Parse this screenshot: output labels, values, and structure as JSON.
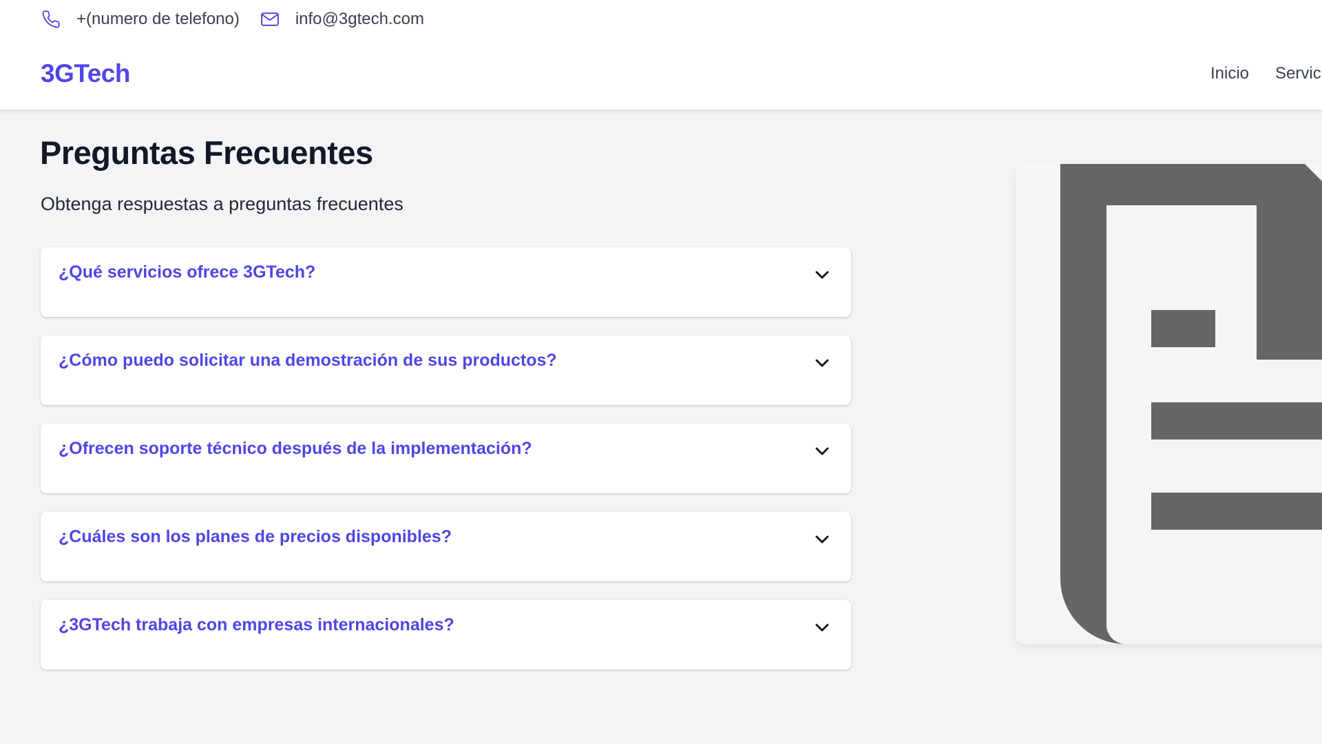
{
  "topbar": {
    "phone": "+(numero de telefono)",
    "email": "info@3gtech.com"
  },
  "brand": "3GTech",
  "nav": [
    "Inicio",
    "Servicios"
  ],
  "faq": {
    "title": "Preguntas Frecuentes",
    "subtitle": "Obtenga respuestas a preguntas frecuentes",
    "items": [
      {
        "question": "¿Qué servicios ofrece 3GTech?"
      },
      {
        "question": "¿Cómo puedo solicitar una demostración de sus productos?"
      },
      {
        "question": "¿Ofrecen soporte técnico después de la implementación?"
      },
      {
        "question": "¿Cuáles son los planes de precios disponibles?"
      },
      {
        "question": "¿3GTech trabaja con empresas internacionales?"
      }
    ]
  },
  "icons": {
    "phone": "phone-icon",
    "email": "mail-icon",
    "chevron": "chevron-down-icon",
    "placeholder": "document-icon"
  },
  "colors": {
    "accent": "#4f46e5",
    "background": "#f3f4f6",
    "placeholder_icon": "#666666"
  }
}
